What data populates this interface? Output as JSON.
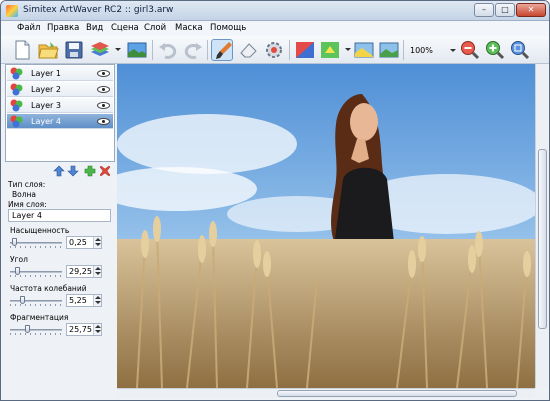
{
  "window": {
    "title": "Simitex ArtWaver RC2 :: girl3.arw",
    "minimize": "–",
    "maximize": "□",
    "close": "✕"
  },
  "menu": [
    "Файл",
    "Правка",
    "Вид",
    "Сцена",
    "Слой",
    "Маска",
    "Помощь"
  ],
  "toolbar": {
    "zoom": "100%",
    "icons": [
      "new-file-icon",
      "open-folder-icon",
      "save-icon",
      "layers-stack-icon",
      "image-icon",
      "undo-icon",
      "redo-icon",
      "brush-icon",
      "eraser-icon",
      "settings-icon",
      "filter-icon",
      "effect-icon",
      "image-adjust-icon",
      "image-transform-icon",
      "zoom-out-icon",
      "zoom-in-icon",
      "zoom-fit-icon"
    ]
  },
  "layers": [
    {
      "label": "Layer 1",
      "selected": false
    },
    {
      "label": "Layer 2",
      "selected": false
    },
    {
      "label": "Layer 3",
      "selected": false
    },
    {
      "label": "Layer 4",
      "selected": true
    }
  ],
  "properties": {
    "type_label": "Тип слоя:",
    "type_value": "Волна",
    "name_label": "Имя слоя:",
    "name_value": "Layer 4",
    "sliders": [
      {
        "label": "Насыщенность",
        "value": "0,25",
        "level": 0.05
      },
      {
        "label": "Угол",
        "value": "29,25",
        "level": 0.1
      },
      {
        "label": "Частота колебаний",
        "value": "5,25",
        "level": 0.2
      },
      {
        "label": "Фрагментация",
        "value": "25,75",
        "level": 0.3
      }
    ]
  },
  "colors": {
    "selected_layer": "#5f8fc7",
    "window_bg": "#eef1f5",
    "sky": "#7fb3e5"
  }
}
